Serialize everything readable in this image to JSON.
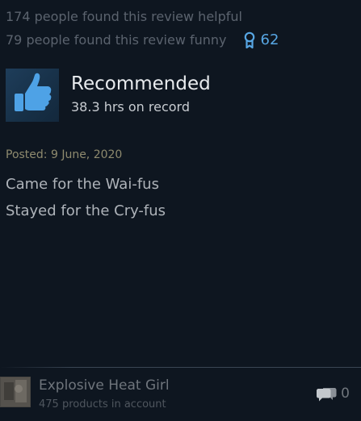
{
  "votes": {
    "helpful_text": "174 people found this review helpful",
    "funny_text": "79 people found this review funny",
    "award_count": "62",
    "award_icon": "award-ribbon-icon"
  },
  "recommendation": {
    "icon": "thumbs-up-icon",
    "title": "Recommended",
    "hours": "38.3 hrs on record"
  },
  "review": {
    "posted": "Posted: 9 June, 2020",
    "lines": [
      "Came for the Wai-fus",
      "Stayed for the Cry-fus"
    ]
  },
  "author": {
    "name": "Explosive Heat Girl",
    "products": "475 products in account",
    "comment_icon": "comment-bubbles-icon",
    "comment_count": "0"
  },
  "colors": {
    "background": "#0e1620",
    "award_blue": "#57a6e3",
    "thumb_blue": "#4ea2e6",
    "posted_gold": "#8e8a6e"
  }
}
